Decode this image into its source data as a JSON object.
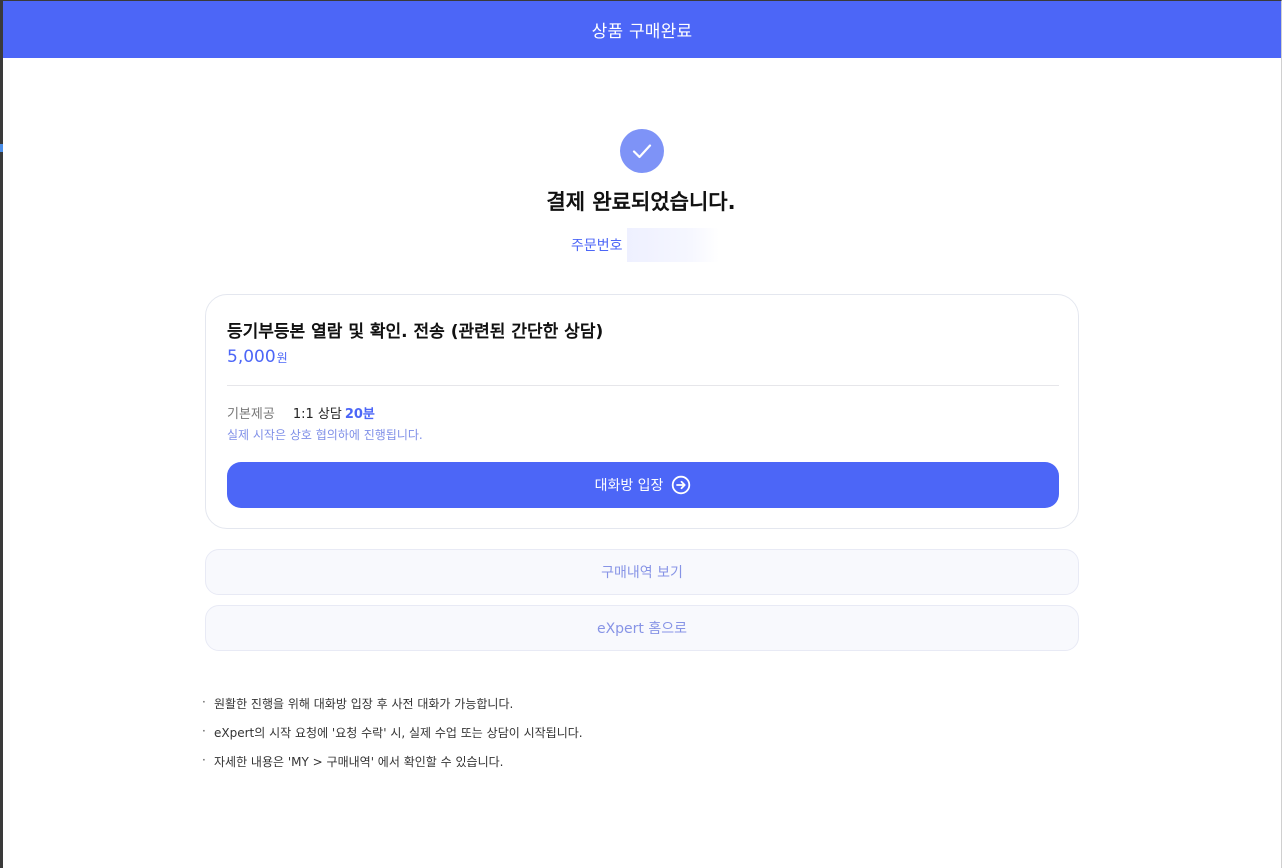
{
  "header": {
    "title": "상품 구매완료"
  },
  "result": {
    "icon": "check-circle-icon",
    "title": "결제 완료되었습니다.",
    "order_label": "주문번호"
  },
  "product": {
    "name": "등기부등본 열람 및 확인. 전송 (관련된 간단한 상담)",
    "price": "5,000",
    "price_unit": "원",
    "offer_label": "기본제공",
    "offer_text": "1:1 상담",
    "offer_minutes": "20분",
    "note": "실제 시작은 상호 협의하에 진행됩니다.",
    "enter_button": "대화방 입장",
    "enter_icon": "arrow-right-circle-icon"
  },
  "buttons": {
    "history": "구매내역 보기",
    "home": "eXpert 홈으로"
  },
  "notes": [
    "원활한 진행을 위해 대화방 입장 후 사전 대화가 가능합니다.",
    "eXpert의 시작 요청에 '요청 수락' 시, 실제 수업 또는 상담이 시작됩니다.",
    "자세한 내용은 'MY > 구매내역' 에서 확인할 수 있습니다."
  ],
  "notes_bullet": "·",
  "colors": {
    "primary": "#4c66f7",
    "check_bg": "#7e93f7",
    "sub_text": "#8794e6"
  }
}
